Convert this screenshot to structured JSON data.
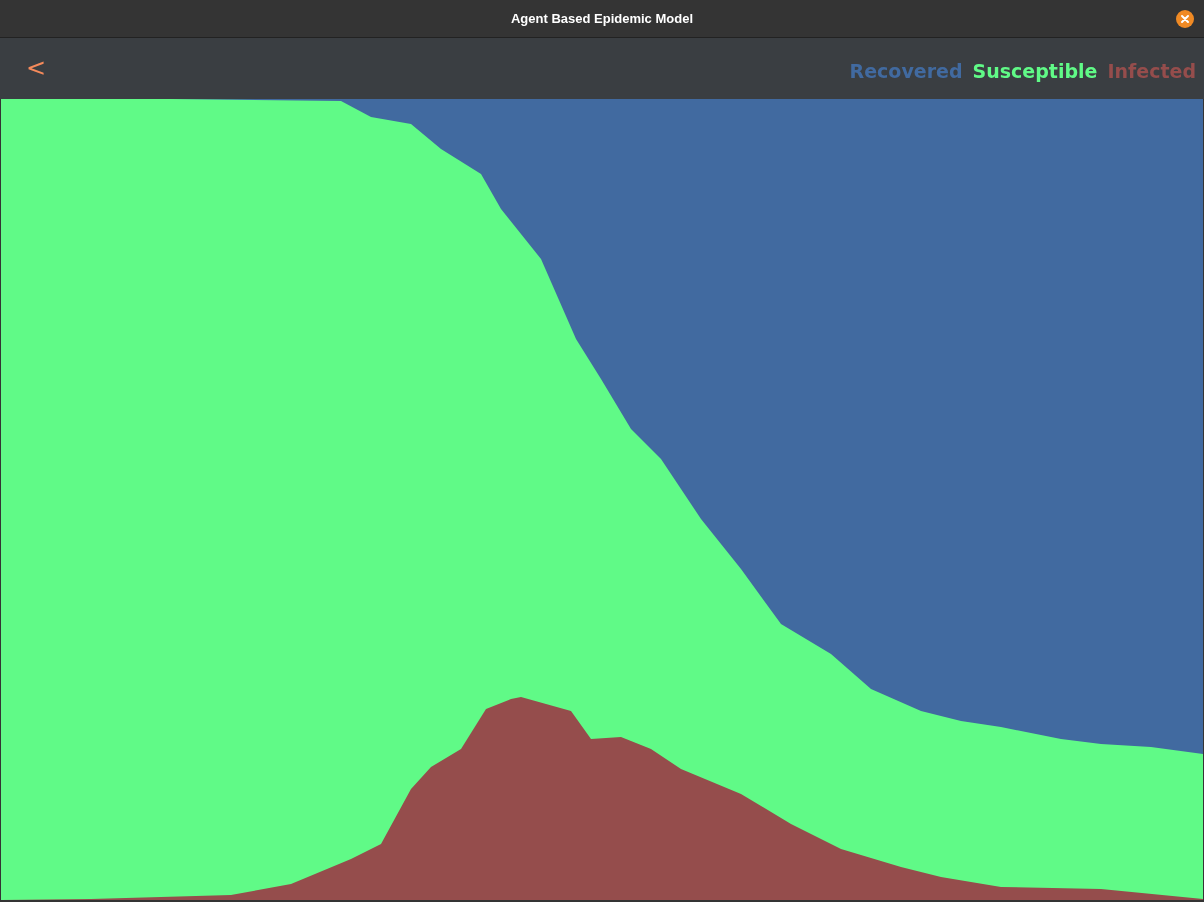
{
  "window": {
    "title": "Agent Based Epidemic Model"
  },
  "toolbar": {
    "back": "<"
  },
  "legend": [
    {
      "label": "Recovered",
      "color": "#416aa0"
    },
    {
      "label": "Susceptible",
      "color": "#60fa87"
    },
    {
      "label": "Infected",
      "color": "#954d4c"
    }
  ]
}
